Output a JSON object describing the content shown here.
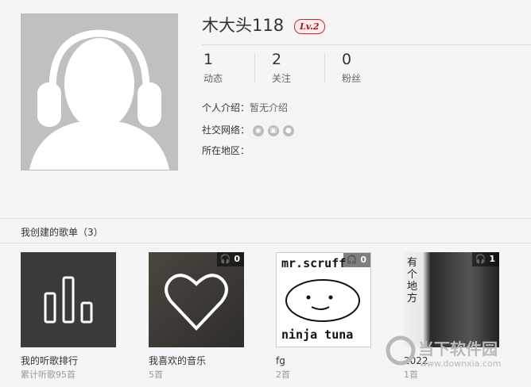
{
  "profile": {
    "username": "木大头118",
    "level": "Lv.2",
    "stats": [
      {
        "num": "1",
        "label": "动态"
      },
      {
        "num": "2",
        "label": "关注"
      },
      {
        "num": "0",
        "label": "粉丝"
      }
    ],
    "intro_label": "个人介绍：",
    "intro_value": "暂无介绍",
    "social_label": "社交网络：",
    "social_icons": [
      "weibo-icon",
      "douban-icon",
      "renren-icon"
    ],
    "region_label": "所在地区："
  },
  "playlists": {
    "title": "我创建的歌单（3）",
    "items": [
      {
        "name": "我的听歌排行",
        "sub": "累计听歌95首",
        "plays": ""
      },
      {
        "name": "我喜欢的音乐",
        "sub": "5首",
        "plays": "0"
      },
      {
        "name": "fg",
        "sub": "2首",
        "plays": "0"
      },
      {
        "name": "2022",
        "sub": "1首",
        "plays": "1"
      }
    ]
  },
  "cover_text": {
    "mrscruff": "mr.scruff",
    "ninjatuna": "ninja tuna",
    "poster_chars": "有个地方"
  },
  "watermark": {
    "brand": "当下软件园",
    "url": "www.downxia.com"
  },
  "colors": {
    "accent": "#c20c0c",
    "background": "#f5f5f5"
  }
}
